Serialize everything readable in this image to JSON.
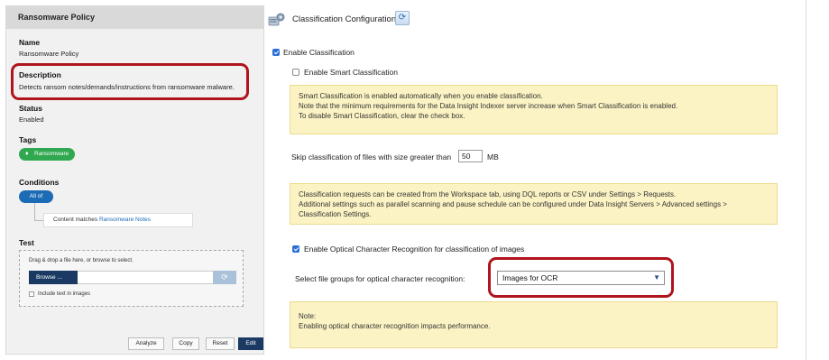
{
  "left_panel": {
    "header": "Ransomware Policy",
    "name": {
      "label": "Name",
      "value": "Ransomware Policy"
    },
    "description": {
      "label": "Description",
      "value": "Detects ransom notes/demands/instructions from ransomware malware."
    },
    "status": {
      "label": "Status",
      "value": "Enabled"
    },
    "tags": {
      "label": "Tags",
      "items": [
        {
          "label": "Ransomware",
          "icon": "tag-icon",
          "color": "#2fa84f"
        }
      ]
    },
    "conditions": {
      "label": "Conditions",
      "operator": "All of",
      "rule_prefix": "Content matches",
      "rule_link": "Ransomware Notes"
    },
    "test": {
      "label": "Test",
      "drop_hint": "Drag & drop a file here, or browse to select.",
      "browse_label": "Browse ...",
      "include_text_label": "Include text in images"
    },
    "buttons": {
      "analyze": "Analyze",
      "copy": "Copy",
      "reset": "Reset",
      "edit": "Edit"
    }
  },
  "right_panel": {
    "title": "Classification Configuration",
    "enable_classification": {
      "label": "Enable Classification",
      "checked": true
    },
    "enable_smart": {
      "label": "Enable Smart Classification",
      "checked": false
    },
    "smart_note": [
      "Smart Classification is enabled automatically when you enable classification.",
      "Note that the minimum requirements for the Data Insight Indexer server increase when Smart Classification is enabled.",
      "To disable Smart Classification, clear the check box."
    ],
    "skip_size": {
      "label": "Skip classification of files with size greater than",
      "value": "50",
      "unit": "MB"
    },
    "requests_note": [
      "Classification requests can be created from the Workspace tab, using DQL reports or CSV under Settings > Requests.",
      "Additional settings such as parallel scanning and pause schedule can be configured under Data Insight Servers > Advanced settings >",
      "Classification Settings."
    ],
    "ocr": {
      "label": "Enable Optical Character Recognition for classification of images",
      "checked": true
    },
    "file_groups": {
      "label": "Select file groups for optical character recognition:",
      "selected": "Images for OCR"
    },
    "ocr_note": [
      "Note:",
      "Enabling optical character recognition impacts performance."
    ]
  },
  "colors": {
    "highlight": "#b0141c",
    "primary": "#1a3a63",
    "accent": "#1c6bb5",
    "tag": "#2fa84f",
    "note_bg": "#fcf3c4"
  }
}
